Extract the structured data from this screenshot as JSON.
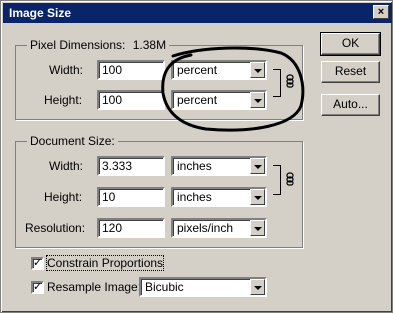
{
  "window": {
    "title": "Image Size",
    "close_glyph": "×"
  },
  "pixel_dimensions": {
    "legend": "Pixel Dimensions:",
    "size": "1.38M",
    "width_label": "Width:",
    "width_value": "100",
    "width_unit": "percent",
    "height_label": "Height:",
    "height_value": "100",
    "height_unit": "percent"
  },
  "document_size": {
    "legend": "Document Size:",
    "width_label": "Width:",
    "width_value": "3.333",
    "width_unit": "inches",
    "height_label": "Height:",
    "height_value": "10",
    "height_unit": "inches",
    "resolution_label": "Resolution:",
    "resolution_value": "120",
    "resolution_unit": "pixels/inch"
  },
  "options": {
    "constrain_label": "Constrain Proportions",
    "constrain_checked": true,
    "resample_label": "Resample Image:",
    "resample_checked": true,
    "resample_method": "Bicubic",
    "check_glyph": "✓"
  },
  "buttons": {
    "ok": "OK",
    "reset": "Reset",
    "auto": "Auto..."
  },
  "icons": {
    "chain": "chain-link-icon",
    "dropdown": "chevron-down-icon"
  },
  "colors": {
    "titlebar": "#0a246a",
    "dialog": "#d4d0c8",
    "annotation": "#000000"
  }
}
